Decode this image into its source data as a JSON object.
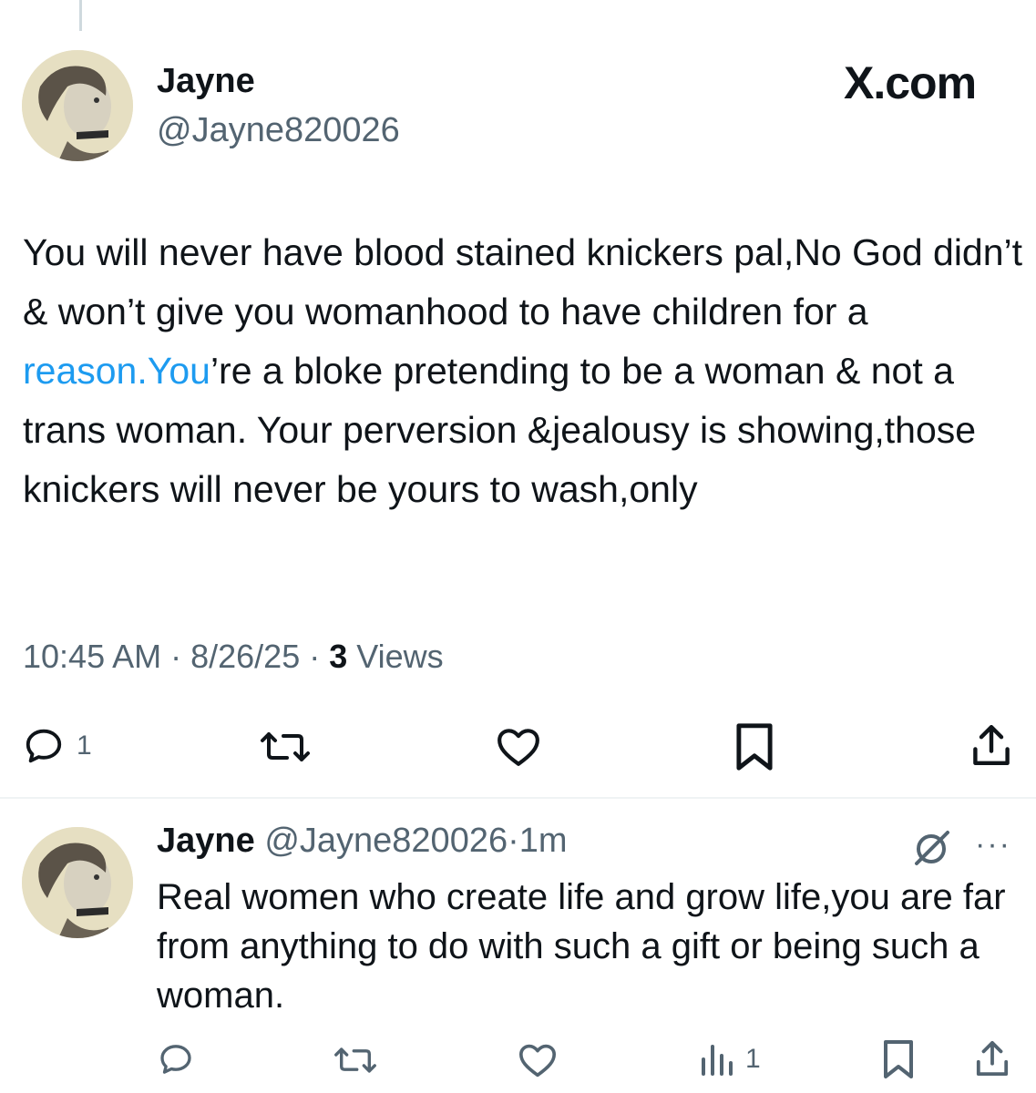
{
  "colors": {
    "link": "#1d9bf0",
    "muted": "#536471",
    "text": "#0f1419",
    "divider": "#eff3f4"
  },
  "main_tweet": {
    "author_name": "Jayne",
    "author_handle": "@Jayne820026",
    "brand": "X.com",
    "text_before_link": "You will never have blood stained knickers pal,No God didn’t & won’t give you womanhood to have children for a ",
    "link_text": "reason.You",
    "text_after_link": "’re a bloke pretending to be a woman & not a trans woman. Your perversion &jealousy is showing,those knickers will never be yours to wash,only",
    "time": "10:45 AM",
    "date": "8/26/25",
    "views_count": "3",
    "views_label": "Views",
    "actions": {
      "reply_icon": "reply-icon",
      "reply_count": "1",
      "repost_icon": "repost-icon",
      "like_icon": "heart-icon",
      "bookmark_icon": "bookmark-icon",
      "share_icon": "share-icon"
    }
  },
  "reply_tweet": {
    "author_name": "Jayne",
    "author_handle": "@Jayne820026",
    "separator": "·",
    "time_ago": "1m",
    "more_label": "···",
    "text": "Real women who create life and grow life,you are far from anything to do with such a gift or being such a woman.",
    "actions": {
      "views_count": "1"
    }
  }
}
